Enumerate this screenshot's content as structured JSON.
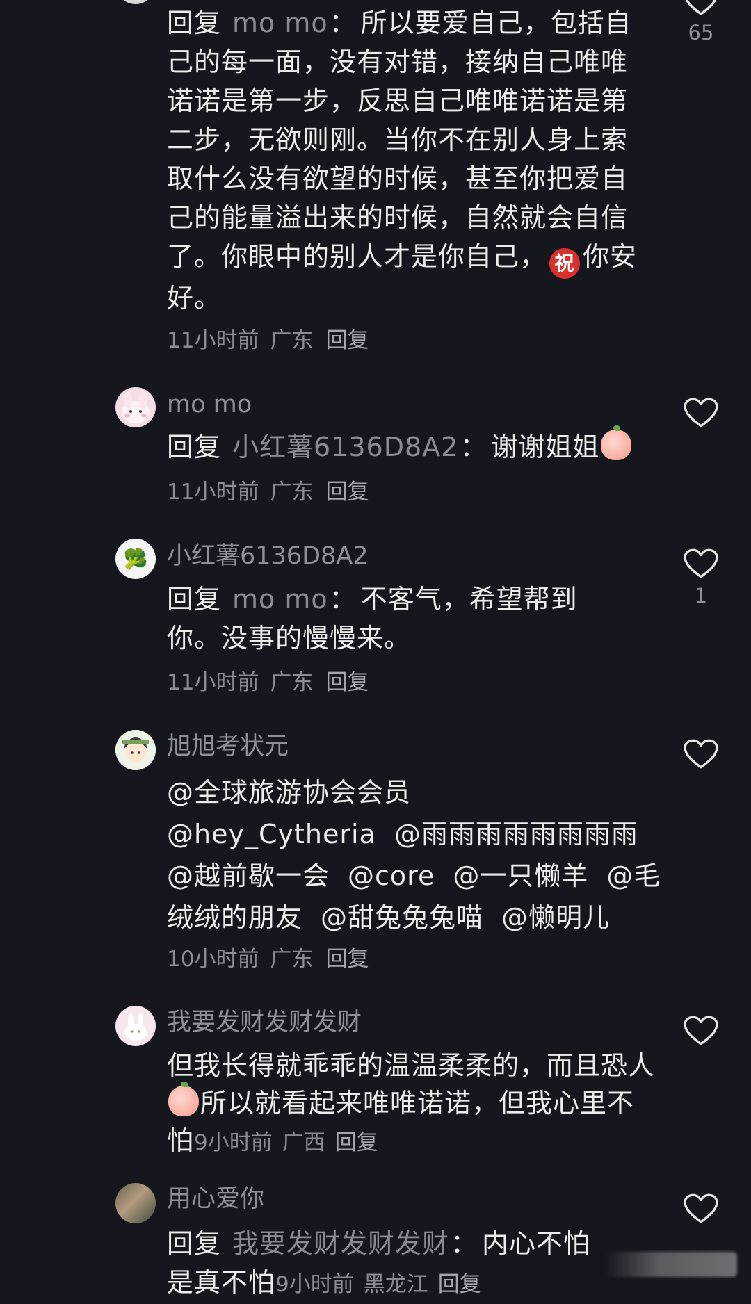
{
  "comments": [
    {
      "reply_prefix": "回复",
      "reply_target": "mo mo",
      "text": "所以要爱自己，包括自己的每一面，没有对错，接纳自己唯唯诺诺是第一步，反思自己唯唯诺诺是第二步，无欲则刚。当你不在别人身上索取什么没有欲望的时候，甚至你把爱自己的能量溢出来的时候，自然就会自信了。你眼中的别人才是你自己，",
      "emoji_bless": "祝",
      "text_after": "你安好。",
      "time": "11小时前",
      "location": "广东",
      "reply_label": "回复",
      "likes": "65"
    },
    {
      "username": "mo mo",
      "reply_prefix": "回复",
      "reply_target": "小红薯6136D8A2",
      "text": "谢谢姐姐",
      "time": "11小时前",
      "location": "广东",
      "reply_label": "回复",
      "likes": ""
    },
    {
      "username": "小红薯6136D8A2",
      "avatar_icon": "🥦",
      "reply_prefix": "回复",
      "reply_target": "mo mo",
      "text": "不客气，希望帮到你。没事的慢慢来。",
      "time": "11小时前",
      "location": "广东",
      "reply_label": "回复",
      "likes": "1"
    },
    {
      "username": "旭旭考状元",
      "mentions": [
        "@全球旅游协会会员",
        "@hey_Cytheria",
        "@雨雨雨雨雨雨雨雨",
        "@越前歇一会",
        "@core",
        "@一只懒羊",
        "@毛绒绒的朋友",
        "@甜兔兔兔喵",
        "@懒明儿"
      ],
      "time": "10小时前",
      "location": "广东",
      "reply_label": "回复",
      "likes": ""
    },
    {
      "username": "我要发财发财发财",
      "text_before": "但我长得就乖乖的温温柔柔的，而且恐人",
      "text_after": "所以就看起来唯唯诺诺，但我心里不怕",
      "time": "9小时前",
      "location": "广西",
      "reply_label": "回复",
      "likes": ""
    },
    {
      "username": "用心爱你",
      "reply_prefix": "回复",
      "reply_target": "我要发财发财发财",
      "text": "内心不怕是真不怕",
      "time": "9小时前",
      "location": "黑龙江",
      "reply_label": "回复",
      "likes": ""
    }
  ]
}
